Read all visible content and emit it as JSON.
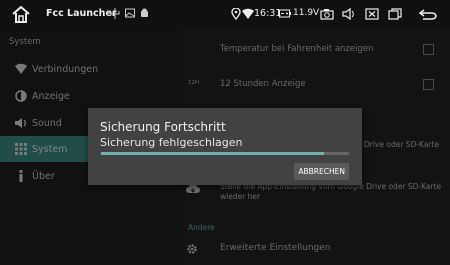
{
  "statusbar": {
    "app_title": "Fcc Launcher",
    "time": "16:31",
    "battery": "11.9V"
  },
  "sidebar": {
    "title": "System",
    "items": [
      {
        "label": "Verbindungen",
        "icon": "wifi-icon"
      },
      {
        "label": "Anzeige",
        "icon": "display-icon"
      },
      {
        "label": "Sound",
        "icon": "speaker-icon"
      },
      {
        "label": "System",
        "icon": "grid-icon",
        "active": true
      },
      {
        "label": "Über",
        "icon": "info-icon"
      }
    ]
  },
  "main": {
    "row_temp": "Temperatur bei Fahrenheit anzeigen",
    "row_12h_icon": "12H",
    "row_12h": "12 Stunden Anzeige",
    "row_backup_tail": "Drive oder SD-Karte",
    "row_restore": "Stelle die App-Einstellung vom Google Drive oder SD-Karte wieder her",
    "section_other": "Andere",
    "row_advanced": "Erweiterte Einstellungen"
  },
  "dialog": {
    "title": "Sicherung Fortschritt",
    "message": "Sicherung fehlgeschlagen",
    "progress": 0.9,
    "cancel_label": "ABBRECHEN"
  },
  "colors": {
    "accent": "#3c8c85",
    "progress": "#6fb1ab"
  }
}
